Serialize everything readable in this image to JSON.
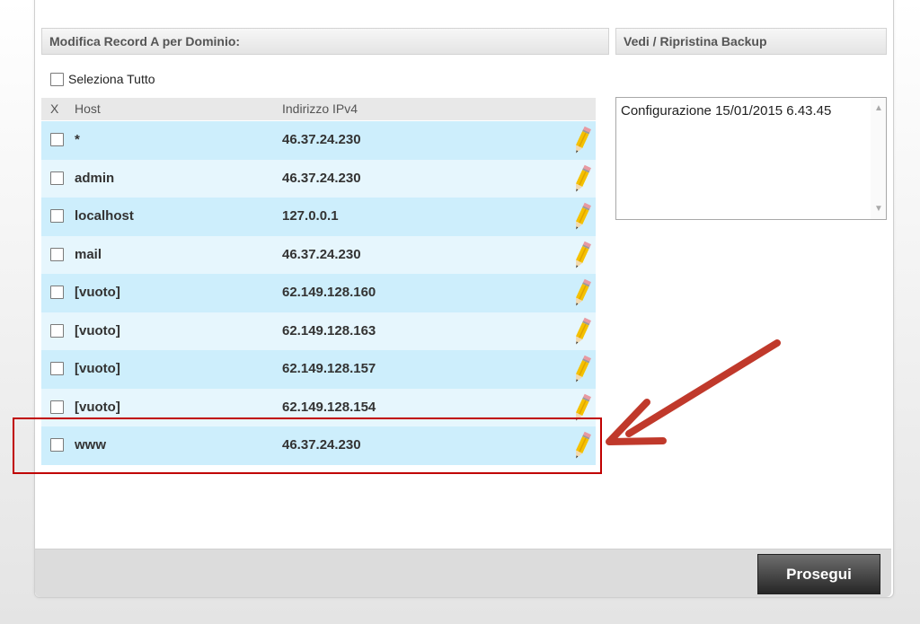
{
  "section_left": {
    "title": "Modifica Record A per Dominio:"
  },
  "section_right": {
    "title": "Vedi / Ripristina Backup"
  },
  "select_all": {
    "label": "Seleziona Tutto"
  },
  "columns": {
    "x": "X",
    "host": "Host",
    "ip": "Indirizzo IPv4"
  },
  "records": [
    {
      "host": "*",
      "ip": "46.37.24.230"
    },
    {
      "host": "admin",
      "ip": "46.37.24.230"
    },
    {
      "host": "localhost",
      "ip": "127.0.0.1"
    },
    {
      "host": "mail",
      "ip": "46.37.24.230"
    },
    {
      "host": "[vuoto]",
      "ip": "62.149.128.160"
    },
    {
      "host": "[vuoto]",
      "ip": "62.149.128.163"
    },
    {
      "host": "[vuoto]",
      "ip": "62.149.128.157"
    },
    {
      "host": "[vuoto]",
      "ip": "62.149.128.154"
    },
    {
      "host": "www",
      "ip": "46.37.24.230"
    }
  ],
  "backups": [
    "Configurazione 15/01/2015 6.43.45"
  ],
  "footer": {
    "button_label": "Prosegui"
  },
  "icons": {
    "edit": "pencil-icon"
  },
  "colors": {
    "row_light": "#e6f6fd",
    "row_dark": "#cdeefc",
    "annotation": "#c0392b",
    "highlight_border": "#c00000"
  }
}
